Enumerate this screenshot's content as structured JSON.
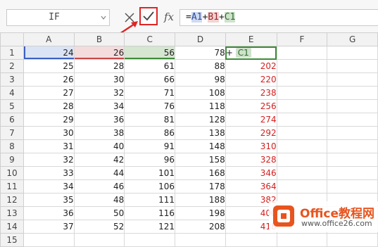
{
  "name_box": {
    "value": "IF"
  },
  "formula_bar": {
    "cancel_symbol": "×",
    "enter_symbol": "✓",
    "fx_label": "fx",
    "formula": {
      "prefix": "=",
      "ref1": "A1",
      "op1": "+",
      "ref2": "B1",
      "op2": "+",
      "ref3": "C1"
    }
  },
  "colors": {
    "accent": "#3d8c38",
    "ref_a1": "#3b5fc4",
    "ref_b1": "#c94646",
    "ref_c1": "#3d8c38",
    "result_red": "#d42020",
    "annotation": "#e02525"
  },
  "columns": [
    "A",
    "B",
    "C",
    "D",
    "E",
    "F",
    "G"
  ],
  "rows": [
    {
      "row": "1",
      "A": "24",
      "B": "26",
      "C": "56",
      "D": "78",
      "E": ""
    },
    {
      "row": "2",
      "A": "25",
      "B": "28",
      "C": "61",
      "D": "88",
      "E": "202"
    },
    {
      "row": "3",
      "A": "26",
      "B": "30",
      "C": "66",
      "D": "98",
      "E": "220"
    },
    {
      "row": "4",
      "A": "27",
      "B": "32",
      "C": "71",
      "D": "108",
      "E": "238"
    },
    {
      "row": "5",
      "A": "28",
      "B": "34",
      "C": "76",
      "D": "118",
      "E": "256"
    },
    {
      "row": "6",
      "A": "29",
      "B": "36",
      "C": "81",
      "D": "128",
      "E": "274"
    },
    {
      "row": "7",
      "A": "30",
      "B": "38",
      "C": "86",
      "D": "138",
      "E": "292"
    },
    {
      "row": "8",
      "A": "31",
      "B": "40",
      "C": "91",
      "D": "148",
      "E": "310"
    },
    {
      "row": "9",
      "A": "32",
      "B": "42",
      "C": "96",
      "D": "158",
      "E": "328"
    },
    {
      "row": "10",
      "A": "33",
      "B": "44",
      "C": "101",
      "D": "168",
      "E": "346"
    },
    {
      "row": "11",
      "A": "34",
      "B": "46",
      "C": "106",
      "D": "178",
      "E": "364"
    },
    {
      "row": "12",
      "A": "35",
      "B": "48",
      "C": "111",
      "D": "188",
      "E": "382"
    },
    {
      "row": "13",
      "A": "36",
      "B": "50",
      "C": "116",
      "D": "198",
      "E": "400"
    },
    {
      "row": "14",
      "A": "37",
      "B": "52",
      "C": "121",
      "D": "208",
      "E": "418"
    },
    {
      "row": "15",
      "A": "",
      "B": "",
      "C": "",
      "D": "",
      "E": ""
    }
  ],
  "active_cell_edit": {
    "text": "+",
    "ref": "C1"
  },
  "watermark": {
    "title": "Office教程网",
    "url": "www.office26.com"
  }
}
